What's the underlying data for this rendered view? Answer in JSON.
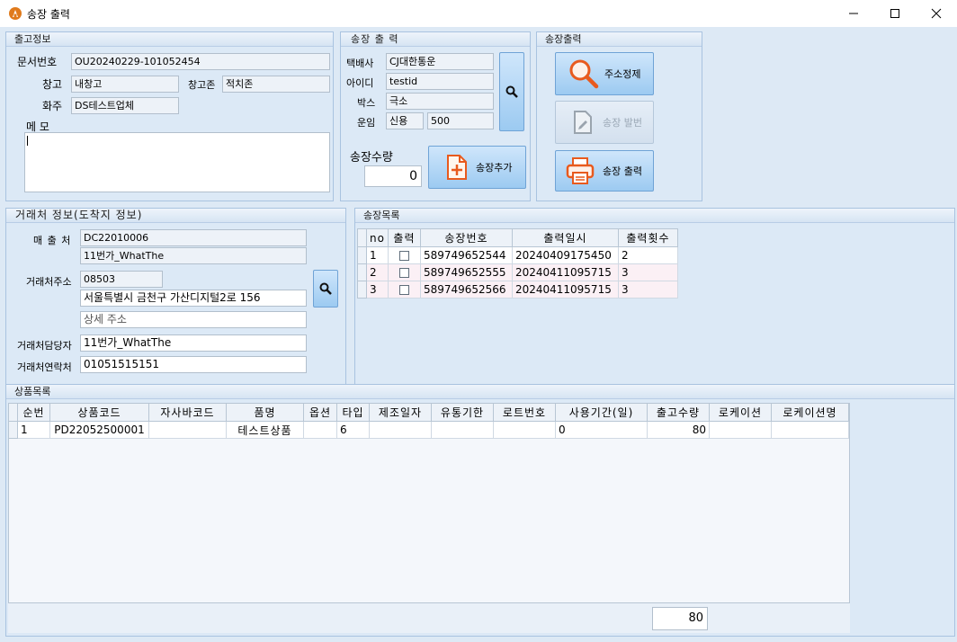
{
  "window": {
    "title": "송장 출력"
  },
  "shipping_info": {
    "section_title": "출고정보",
    "doc_no_label": "문서번호",
    "doc_no": "OU20240229-101052454",
    "warehouse_label": "창고",
    "warehouse": "내창고",
    "zone_label": "창고존",
    "zone": "적치존",
    "owner_label": "화주",
    "owner": "DS테스트업체",
    "memo_label": "메 모",
    "memo": ""
  },
  "invoice_print": {
    "section_title": "송장 출 력",
    "courier_label": "택배사",
    "courier": "CJ대한통운",
    "id_label": "아이디",
    "id": "testid",
    "box_label": "박스",
    "box": "극소",
    "fare_label": "운임",
    "fare_type": "신용",
    "fare_amount": "500",
    "qty_label": "송장수량",
    "qty": "0",
    "add_button": "송장추가"
  },
  "invoice_actions": {
    "section_title": "송장출력",
    "address_refine": "주소정제",
    "issue": "송장 발번",
    "print": "송장 출력"
  },
  "partner": {
    "section_title": "거래처 정보(도착지 정보)",
    "seller_label": "매 출 처",
    "seller_code": "DC22010006",
    "seller_name": "11번가_WhatThe",
    "addr_label": "거래처주소",
    "zip": "08503",
    "addr1": "서울특별시 금천구 가산디지털2로 156",
    "addr2_placeholder": "상세 주소",
    "contact_label": "거래처담당자",
    "contact": "11번가_WhatThe",
    "phone_label": "거래처연락처",
    "phone": "01051515151"
  },
  "invoice_list": {
    "section_title": "송장목록",
    "columns": [
      "no",
      "출력",
      "송장번호",
      "출력일시",
      "출력횟수"
    ],
    "rows": [
      {
        "no": "1",
        "invoice": "589749652544",
        "printed_at": "20240409175450",
        "count": "2"
      },
      {
        "no": "2",
        "invoice": "589749652555",
        "printed_at": "20240411095715",
        "count": "3"
      },
      {
        "no": "3",
        "invoice": "589749652566",
        "printed_at": "20240411095715",
        "count": "3"
      }
    ]
  },
  "product_list": {
    "section_title": "상품목록",
    "columns": [
      "순번",
      "상품코드",
      "자사바코드",
      "품명",
      "옵션",
      "타입",
      "제조일자",
      "유통기한",
      "로트번호",
      "사용기간(일)",
      "출고수량",
      "로케이션",
      "로케이션명"
    ],
    "rows": [
      {
        "seq": "1",
        "code": "PD22052500001",
        "barcode": "",
        "name": "테스트상품",
        "option": "",
        "type": "6",
        "mfg": "",
        "exp": "",
        "lot": "",
        "period": "0",
        "qty": "80",
        "loc": "",
        "loc_name": ""
      }
    ],
    "total_qty": "80"
  }
}
